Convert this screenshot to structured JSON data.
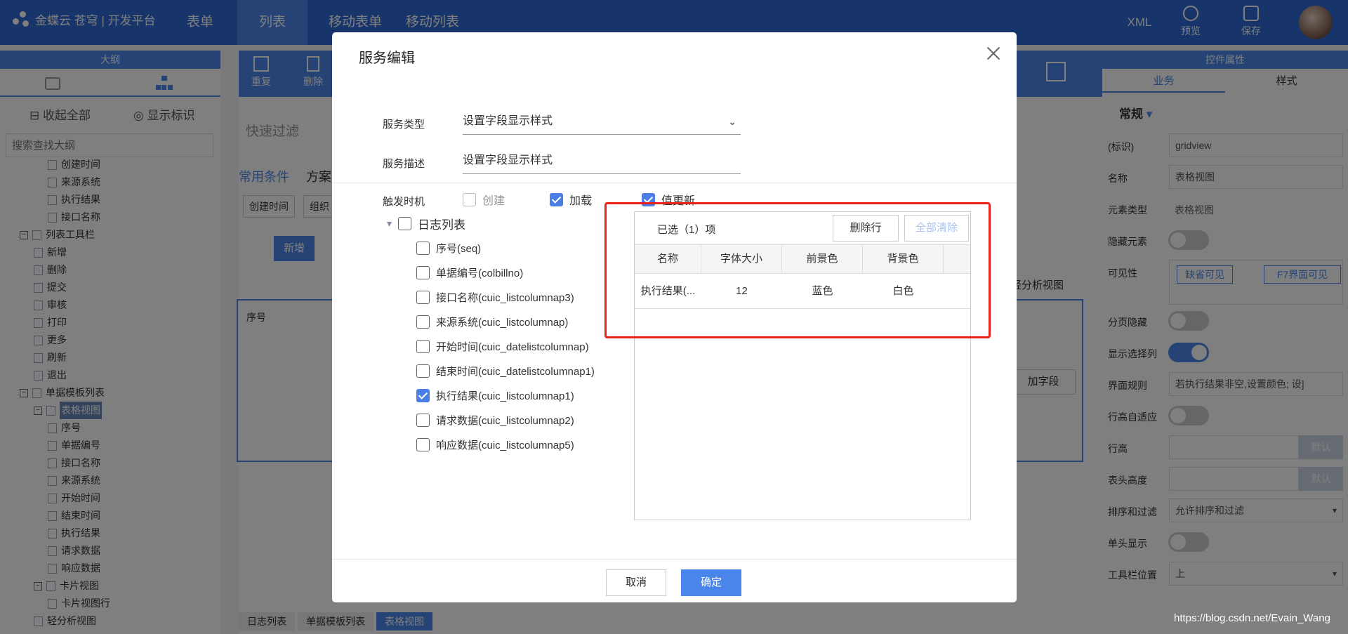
{
  "topbar": {
    "logo": "金蝶云 苍穹 | 开发平台",
    "tabs": [
      "表单",
      "列表",
      "移动表单",
      "移动列表"
    ],
    "active_tab": "列表",
    "xml_label": "XML",
    "preview_label": "预览",
    "save_label": "保存"
  },
  "left_panel": {
    "header": "大纲",
    "collapse_all": "收起全部",
    "show_marks": "显示标识",
    "search_placeholder": "搜索查找大纲",
    "tree": [
      {
        "label": "创建时间",
        "indent": 3,
        "type": "doc"
      },
      {
        "label": "来源系统",
        "indent": 3,
        "type": "doc"
      },
      {
        "label": "执行结果",
        "indent": 3,
        "type": "doc"
      },
      {
        "label": "接口名称",
        "indent": 3,
        "type": "doc"
      },
      {
        "label": "列表工具栏",
        "indent": 1,
        "type": "folder",
        "expanded": true
      },
      {
        "label": "新增",
        "indent": 2,
        "type": "doc"
      },
      {
        "label": "删除",
        "indent": 2,
        "type": "doc"
      },
      {
        "label": "提交",
        "indent": 2,
        "type": "doc"
      },
      {
        "label": "审核",
        "indent": 2,
        "type": "doc"
      },
      {
        "label": "打印",
        "indent": 2,
        "type": "doc"
      },
      {
        "label": "更多",
        "indent": 2,
        "type": "doc"
      },
      {
        "label": "刷新",
        "indent": 2,
        "type": "doc"
      },
      {
        "label": "退出",
        "indent": 2,
        "type": "doc"
      },
      {
        "label": "单据模板列表",
        "indent": 1,
        "type": "folder",
        "expanded": true
      },
      {
        "label": "表格视图",
        "indent": 2,
        "type": "folder",
        "expanded": true,
        "selected": true
      },
      {
        "label": "序号",
        "indent": 3,
        "type": "doc"
      },
      {
        "label": "单据编号",
        "indent": 3,
        "type": "doc"
      },
      {
        "label": "接口名称",
        "indent": 3,
        "type": "doc"
      },
      {
        "label": "来源系统",
        "indent": 3,
        "type": "doc"
      },
      {
        "label": "开始时间",
        "indent": 3,
        "type": "doc"
      },
      {
        "label": "结束时间",
        "indent": 3,
        "type": "doc"
      },
      {
        "label": "执行结果",
        "indent": 3,
        "type": "doc"
      },
      {
        "label": "请求数据",
        "indent": 3,
        "type": "doc"
      },
      {
        "label": "响应数据",
        "indent": 3,
        "type": "doc"
      },
      {
        "label": "卡片视图",
        "indent": 2,
        "type": "folder",
        "expanded": true
      },
      {
        "label": "卡片视图行",
        "indent": 3,
        "type": "doc"
      },
      {
        "label": "轻分析视图",
        "indent": 2,
        "type": "doc"
      }
    ]
  },
  "center": {
    "toolbar": [
      "重复",
      "删除"
    ],
    "quick_filter": "快速过滤",
    "common_conditions": "常用条件",
    "plan": "方案",
    "filter_chips": [
      "创建时间",
      "组织"
    ],
    "new_button": "新增",
    "seq_header": "序号",
    "light_analysis": "轻分析视图",
    "add_field": "加字段",
    "breadcrumb": [
      "日志列表",
      "单据模板列表",
      "表格视图"
    ]
  },
  "right_panel": {
    "header": "控件属性",
    "tabs": [
      "业务",
      "样式"
    ],
    "section": "常规",
    "rows": [
      {
        "label": "(标识)",
        "value": "gridview",
        "kind": "input"
      },
      {
        "label": "名称",
        "value": "表格视图",
        "kind": "input"
      },
      {
        "label": "元素类型",
        "value": "表格视图",
        "kind": "text"
      },
      {
        "label": "隐藏元素",
        "kind": "toggle",
        "on": false
      },
      {
        "label": "可见性",
        "kind": "visibility",
        "buttons": [
          "缺省可见",
          "F7界面可见"
        ]
      },
      {
        "label": "分页隐藏",
        "kind": "toggle",
        "on": false
      },
      {
        "label": "显示选择列",
        "kind": "toggle",
        "on": true
      },
      {
        "label": "界面规则",
        "value": "若执行结果非空,设置颜色; 设]",
        "kind": "input"
      },
      {
        "label": "行高自适应",
        "kind": "toggle",
        "on": false
      },
      {
        "label": "行高",
        "value": "",
        "kind": "default",
        "suffix": "默认"
      },
      {
        "label": "表头高度",
        "value": "",
        "kind": "default",
        "suffix": "默认"
      },
      {
        "label": "排序和过滤",
        "value": "允许排序和过滤",
        "kind": "select"
      },
      {
        "label": "单头显示",
        "kind": "toggle",
        "on": false
      },
      {
        "label": "工具栏位置",
        "value": "上",
        "kind": "select"
      }
    ]
  },
  "modal": {
    "title": "服务编辑",
    "service_type_label": "服务类型",
    "service_type_value": "设置字段显示样式",
    "service_desc_label": "服务描述",
    "service_desc_value": "设置字段显示样式",
    "trigger_label": "触发时机",
    "triggers": [
      {
        "label": "创建",
        "checked": false,
        "disabled": true
      },
      {
        "label": "加载",
        "checked": true,
        "disabled": false
      },
      {
        "label": "值更新",
        "checked": true,
        "disabled": false
      }
    ],
    "field_root": "日志列表",
    "fields": [
      {
        "label": "序号(seq)",
        "checked": false
      },
      {
        "label": "单据编号(colbillno)",
        "checked": false
      },
      {
        "label": "接口名称(cuic_listcolumnap3)",
        "checked": false
      },
      {
        "label": "来源系统(cuic_listcolumnap)",
        "checked": false
      },
      {
        "label": "开始时间(cuic_datelistcolumnap)",
        "checked": false
      },
      {
        "label": "结束时间(cuic_datelistcolumnap1)",
        "checked": false
      },
      {
        "label": "执行结果(cuic_listcolumnap1)",
        "checked": true
      },
      {
        "label": "请求数据(cuic_listcolumnap2)",
        "checked": false
      },
      {
        "label": "响应数据(cuic_listcolumnap5)",
        "checked": false
      }
    ],
    "selected_count": "已选（1）项",
    "delete_row": "删除行",
    "clear_all": "全部清除",
    "columns": [
      "名称",
      "字体大小",
      "前景色",
      "背景色"
    ],
    "rows": [
      [
        "执行结果(...",
        "12",
        "蓝色",
        "白色"
      ]
    ],
    "cancel": "取消",
    "confirm": "确定"
  },
  "watermark": "https://blog.csdn.net/Evain_Wang"
}
